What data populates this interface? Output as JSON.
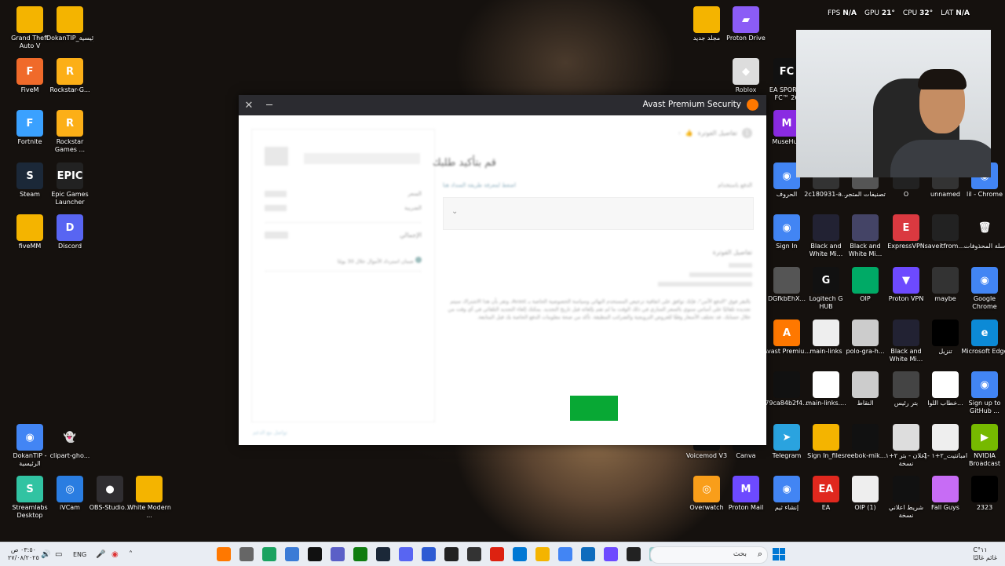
{
  "hud": {
    "fps_label": "FPS",
    "fps_value": "N/A",
    "gpu_label": "GPU",
    "gpu_value": "21°",
    "cpu_label": "CPU",
    "cpu_value": "32°",
    "lat_label": "LAT",
    "lat_value": "N/A"
  },
  "desktop_left": [
    {
      "label": "Grand Theft Auto V",
      "glyph": "",
      "color": "#f4b400"
    },
    {
      "label": "DokanTIP_الرئيسية_files",
      "glyph": "",
      "color": "#f4b400"
    },
    {
      "label": "FiveM",
      "glyph": "F",
      "color": "#f06a2a"
    },
    {
      "label": "Rockstar-G...",
      "glyph": "R",
      "color": "#fcaf17"
    },
    {
      "label": "Fortnite",
      "glyph": "F",
      "color": "#3aa1ff"
    },
    {
      "label": "Rockstar Games ...",
      "glyph": "R",
      "color": "#fcaf17"
    },
    {
      "label": "Steam",
      "glyph": "S",
      "color": "#1b2838"
    },
    {
      "label": "Epic Games Launcher",
      "glyph": "EPIC",
      "color": "#222"
    },
    {
      "label": "fiveMM",
      "glyph": "",
      "color": "#f4b400"
    },
    {
      "label": "Discord",
      "glyph": "D",
      "color": "#5865f2"
    },
    {
      "label": "DokanTIP - الرئيسية",
      "glyph": "◉",
      "color": "#4285f4"
    },
    {
      "label": "clipart-gho...",
      "glyph": "👻",
      "color": "transparent"
    },
    {
      "label": "Streamlabs Desktop",
      "glyph": "S",
      "color": "#31c3a2"
    },
    {
      "label": "iVCam",
      "glyph": "◎",
      "color": "#2a7de1"
    },
    {
      "label": "OBS-Studio...",
      "glyph": "●",
      "color": "#302e31"
    },
    {
      "label": "White Modern ...",
      "glyph": "",
      "color": "#f4b400"
    }
  ],
  "desktop_right": [
    {
      "label": "مجلد جديد",
      "glyph": "",
      "color": "#f4b400"
    },
    {
      "label": "Proton Drive",
      "glyph": "▰",
      "color": "#8b5cf6"
    },
    {
      "label": "Roblox",
      "glyph": "◆",
      "color": "#ddd"
    },
    {
      "label": "EA SPORTS FC™ 26",
      "glyph": "FC",
      "color": "#111"
    },
    {
      "label": "MuseHub",
      "glyph": "M",
      "color": "#8a2be2"
    },
    {
      "label": "الحروف",
      "glyph": "◉",
      "color": "#4285f4"
    },
    {
      "label": "2c180931-a...",
      "glyph": "",
      "color": "#333"
    },
    {
      "label": "تصنيفات المتجر",
      "glyph": "",
      "color": "#555"
    },
    {
      "label": "O",
      "glyph": "",
      "color": "#222"
    },
    {
      "label": "unnamed",
      "glyph": "",
      "color": "#333"
    },
    {
      "label": "lil - Chrome",
      "glyph": "◉",
      "color": "#4285f4"
    },
    {
      "label": "Sign In",
      "glyph": "◉",
      "color": "#4285f4"
    },
    {
      "label": "Black and White Mi...",
      "glyph": "",
      "color": "#223"
    },
    {
      "label": "Black and White Mi...",
      "glyph": "",
      "color": "#446"
    },
    {
      "label": "ExpressVPN",
      "glyph": "E",
      "color": "#da3940"
    },
    {
      "label": "saveitfrom....",
      "glyph": "",
      "color": "#222"
    },
    {
      "label": "سلة المحذوفات",
      "glyph": "🗑",
      "color": "transparent"
    },
    {
      "label": "DGfkbEhX...",
      "glyph": "",
      "color": "#555"
    },
    {
      "label": "Logitech G HUB",
      "glyph": "G",
      "color": "#111"
    },
    {
      "label": "OIP",
      "glyph": "",
      "color": "#0a6"
    },
    {
      "label": "Proton VPN",
      "glyph": "▼",
      "color": "#6d4aff"
    },
    {
      "label": "maybe",
      "glyph": "",
      "color": "#333"
    },
    {
      "label": "Google Chrome",
      "glyph": "◉",
      "color": "#4285f4"
    },
    {
      "label": "Avast Premiu...",
      "glyph": "A",
      "color": "#ff7800"
    },
    {
      "label": "main-links",
      "glyph": "",
      "color": "#eee"
    },
    {
      "label": "polo-gra-h...",
      "glyph": "",
      "color": "#ccc"
    },
    {
      "label": "Black and White Mi...",
      "glyph": "",
      "color": "#223"
    },
    {
      "label": "تنزيل",
      "glyph": "",
      "color": "#000"
    },
    {
      "label": "Microsoft Edge",
      "glyph": "e",
      "color": "#0c8ad6"
    },
    {
      "label": "79ca84b2f4...",
      "glyph": "",
      "color": "#111"
    },
    {
      "label": "main-links....",
      "glyph": "",
      "color": "#fff"
    },
    {
      "label": "النقاط",
      "glyph": "",
      "color": "#ccc"
    },
    {
      "label": "بتر رئيس",
      "glyph": "",
      "color": "#444"
    },
    {
      "label": "خطاب اللوا...",
      "glyph": "",
      "color": "#fff"
    },
    {
      "label": "Sign up to GitHub ...",
      "glyph": "◉",
      "color": "#4285f4"
    },
    {
      "label": "Voicemod V3",
      "glyph": "",
      "color": "#111"
    },
    {
      "label": "Canva",
      "glyph": "",
      "color": "#111"
    },
    {
      "label": "Telegram",
      "glyph": "➤",
      "color": "#2aa3df"
    },
    {
      "label": "Sign In_files",
      "glyph": "",
      "color": "#f4b400"
    },
    {
      "label": "reebok-mik...",
      "glyph": "",
      "color": "#111"
    },
    {
      "label": "إعلان - بتر ٢+١ نسخة",
      "glyph": "",
      "color": "#ddd"
    },
    {
      "label": "امبانتيت_٢+١ -1",
      "glyph": "",
      "color": "#eee"
    },
    {
      "label": "NVIDIA Broadcast",
      "glyph": "▶",
      "color": "#76b900"
    },
    {
      "label": "Overwatch",
      "glyph": "◎",
      "color": "#f99e1a"
    },
    {
      "label": "Proton Mail",
      "glyph": "M",
      "color": "#6d4aff"
    },
    {
      "label": "إنشاء ثيم",
      "glyph": "◉",
      "color": "#4285f4"
    },
    {
      "label": "EA",
      "glyph": "EA",
      "color": "#e0281e"
    },
    {
      "label": "OIP (1)",
      "glyph": "",
      "color": "#eee"
    },
    {
      "label": "شريط اعلاني نسخة",
      "glyph": "",
      "color": "#111"
    },
    {
      "label": "Fall Guys",
      "glyph": "",
      "color": "#c76cf5"
    },
    {
      "label": "2323",
      "glyph": "",
      "color": "#000"
    }
  ],
  "window": {
    "title": "Avast Premium Security",
    "close_glyph": "✕",
    "minimize_glyph": "─",
    "step_label": "تفاصيل الفوترة",
    "step_number": "1",
    "heading": "قم بتأكيد طلبك",
    "pay_label": "الدفع باستخدام",
    "pay_link": "اضغط لمعرفة طريقة السداد هنا",
    "billing_label": "تفاصيل الفوترة",
    "price_label": "السعر",
    "tax_label": "الضريبة",
    "total_label": "الإجمالي",
    "guarantee": "ضمان استرداد الأموال خلال 30 يومًا",
    "legal_text": "بالنقر فوق \"الدفع الآمن\"، فإنك توافق على اتفاقية ترخيص المستخدم النهائي وسياسة الخصوصية الخاصة بـ Avast، وتقر بأن هذا الاشتراك سيتم تجديده تلقائيًا على أساس سنوي بالسعر الساري في ذلك الوقت ما لم تقم بإلغائه قبل تاريخ التجديد. يمكنك إلغاء التجديد التلقائي في أي وقت من خلال حسابك. قد تختلف الأسعار وفقًا للعروض الترويجية والضرائب المطبقة. تأكد من صحة معلومات الدفع الخاصة بك قبل المتابعة.",
    "footer_link": "تواصل مع الدعم",
    "chevron_glyph": "⌄"
  },
  "taskbar": {
    "time": "٠٣:٥٠ ص",
    "date": "٢٧/٠٨/٢٠٢٥",
    "language": "ENG",
    "search_placeholder": "بحث",
    "weather_temp": "١١°C",
    "weather_label": "غائم غالبًا",
    "apps": [
      {
        "name": "avast",
        "color": "#ff7800"
      },
      {
        "name": "settings",
        "color": "#666"
      },
      {
        "name": "maps",
        "color": "#1aa260"
      },
      {
        "name": "notepad",
        "color": "#3b7bd6"
      },
      {
        "name": "steam-alt",
        "color": "#111"
      },
      {
        "name": "teams",
        "color": "#5b5fc7"
      },
      {
        "name": "xbox",
        "color": "#107c10"
      },
      {
        "name": "steam",
        "color": "#1b2838"
      },
      {
        "name": "discord",
        "color": "#5865f2"
      },
      {
        "name": "headset",
        "color": "#2d5bd3"
      },
      {
        "name": "epic",
        "color": "#222"
      },
      {
        "name": "game",
        "color": "#333"
      },
      {
        "name": "rockstar",
        "color": "#d21"
      },
      {
        "name": "store",
        "color": "#0078d4"
      },
      {
        "name": "explorer",
        "color": "#f4b400"
      },
      {
        "name": "chrome",
        "color": "#4285f4"
      },
      {
        "name": "outlook",
        "color": "#0f6cbd"
      },
      {
        "name": "vpn",
        "color": "#6d4aff"
      },
      {
        "name": "terminal",
        "color": "#222"
      },
      {
        "name": "snow",
        "color": "#9cc"
      }
    ]
  }
}
